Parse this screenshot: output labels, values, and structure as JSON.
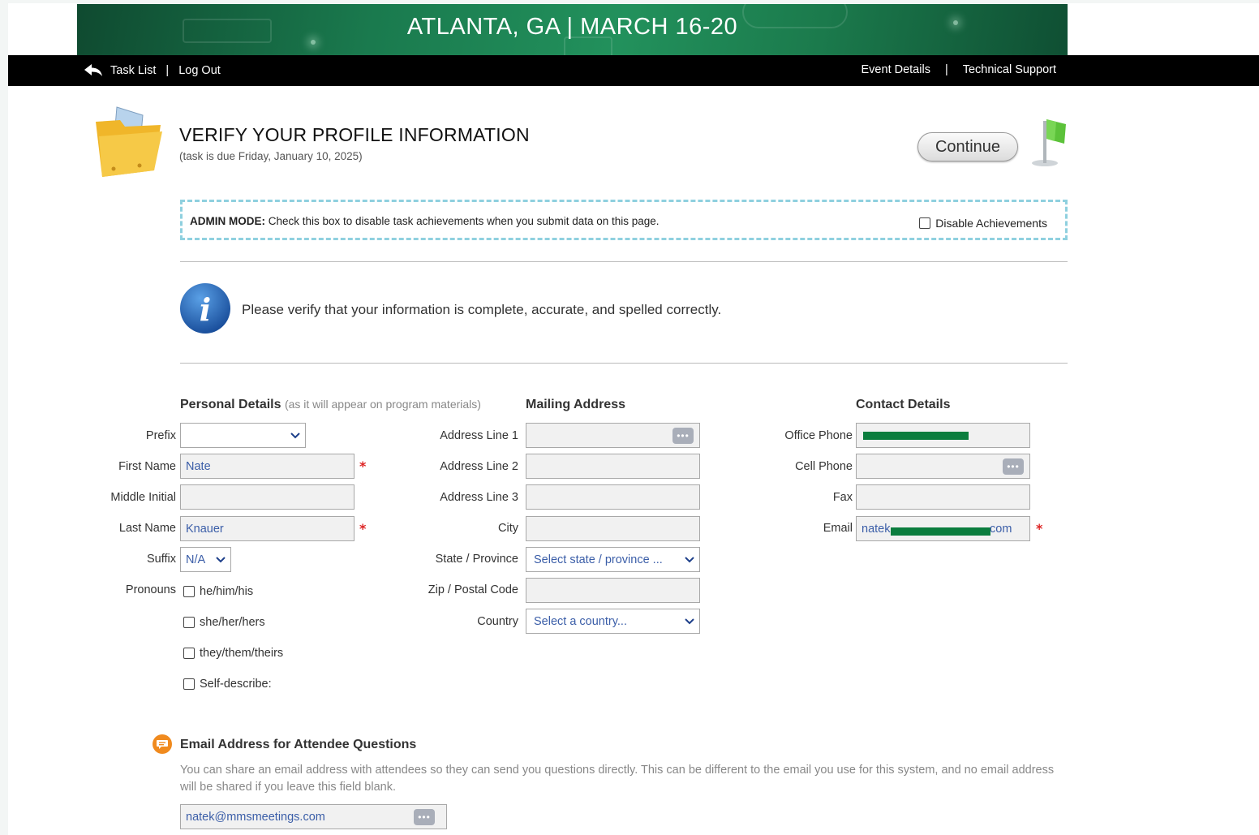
{
  "banner": {
    "title": "ATLANTA, GA | MARCH 16-20"
  },
  "nav": {
    "task_list": "Task List",
    "separator": "|",
    "log_out": "Log Out",
    "event_details": "Event Details",
    "technical_support": "Technical Support"
  },
  "header": {
    "title": "VERIFY YOUR PROFILE INFORMATION",
    "due": "(task is due Friday, January 10, 2025)",
    "continue_label": "Continue"
  },
  "admin": {
    "label": "ADMIN MODE:",
    "text": " Check this box to disable task achievements when you submit data on this page.",
    "checkbox_label": "Disable Achievements"
  },
  "info": {
    "text": "Please verify that your information is complete, accurate, and spelled correctly."
  },
  "personal": {
    "heading": "Personal Details",
    "note": "(as it will appear on program materials)",
    "prefix_label": "Prefix",
    "prefix_value": "",
    "first_name_label": "First Name",
    "first_name_value": "Nate",
    "middle_initial_label": "Middle Initial",
    "middle_initial_value": "",
    "last_name_label": "Last Name",
    "last_name_value": "Knauer",
    "suffix_label": "Suffix",
    "suffix_value": "N/A",
    "pronouns_label": "Pronouns",
    "pronouns": [
      "he/him/his",
      "she/her/hers",
      "they/them/theirs",
      "Self-describe:"
    ]
  },
  "mailing": {
    "heading": "Mailing Address",
    "address1_label": "Address Line 1",
    "address2_label": "Address Line 2",
    "address3_label": "Address Line 3",
    "city_label": "City",
    "state_label": "State / Province",
    "state_placeholder": "Select state / province ...",
    "zip_label": "Zip / Postal Code",
    "country_label": "Country",
    "country_placeholder": "Select a country..."
  },
  "contact": {
    "heading": "Contact Details",
    "office_phone_label": "Office Phone",
    "cell_phone_label": "Cell Phone",
    "fax_label": "Fax",
    "email_label": "Email",
    "email_prefix": "natek",
    "email_suffix": "com"
  },
  "attendee_questions": {
    "title": "Email Address for Attendee Questions",
    "description": "You can share an email address with attendees so they can send you questions directly. This can be different to the email you use for this system, and no email address will be shared if you leave this field blank.",
    "email_value": "natek@mmsmeetings.com"
  },
  "colors": {
    "banner_green": "#1a7a4e",
    "nav_black": "#000000",
    "required_red": "#dd2222",
    "input_text_blue": "#3b5ea8"
  }
}
